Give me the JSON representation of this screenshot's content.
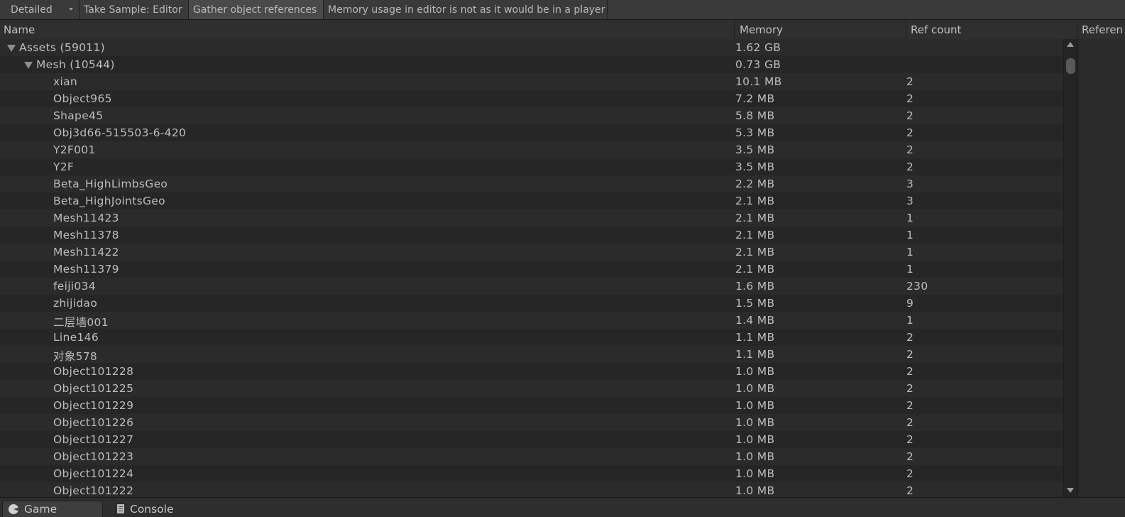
{
  "toolbar": {
    "mode_dropdown": "Detailed",
    "take_sample": "Take Sample: Editor",
    "gather_refs": "Gather object references",
    "note": "Memory usage in editor is not as it would be in a player"
  },
  "columns": {
    "name": "Name",
    "memory": "Memory",
    "ref_count": "Ref count",
    "referenced_by": "Referen"
  },
  "tree": {
    "assets": {
      "label": "Assets (59011)",
      "memory": "1.62 GB"
    },
    "mesh": {
      "label": "Mesh (10544)",
      "memory": "0.73 GB"
    }
  },
  "rows": [
    {
      "name": "xian",
      "memory": "10.1 MB",
      "refs": "2"
    },
    {
      "name": "Object965",
      "memory": "7.2 MB",
      "refs": "2"
    },
    {
      "name": "Shape45",
      "memory": "5.8 MB",
      "refs": "2"
    },
    {
      "name": "Obj3d66-515503-6-420",
      "memory": "5.3 MB",
      "refs": "2"
    },
    {
      "name": "Y2F001",
      "memory": "3.5 MB",
      "refs": "2"
    },
    {
      "name": "Y2F",
      "memory": "3.5 MB",
      "refs": "2"
    },
    {
      "name": "Beta_HighLimbsGeo",
      "memory": "2.2 MB",
      "refs": "3"
    },
    {
      "name": "Beta_HighJointsGeo",
      "memory": "2.1 MB",
      "refs": "3"
    },
    {
      "name": "Mesh11423",
      "memory": "2.1 MB",
      "refs": "1"
    },
    {
      "name": "Mesh11378",
      "memory": "2.1 MB",
      "refs": "1"
    },
    {
      "name": "Mesh11422",
      "memory": "2.1 MB",
      "refs": "1"
    },
    {
      "name": "Mesh11379",
      "memory": "2.1 MB",
      "refs": "1"
    },
    {
      "name": "feiji034",
      "memory": "1.6 MB",
      "refs": "230"
    },
    {
      "name": "zhijidao",
      "memory": "1.5 MB",
      "refs": "9"
    },
    {
      "name": "二层墙001",
      "memory": "1.4 MB",
      "refs": "1"
    },
    {
      "name": "Line146",
      "memory": "1.1 MB",
      "refs": "2"
    },
    {
      "name": "对象578",
      "memory": "1.1 MB",
      "refs": "2"
    },
    {
      "name": "Object101228",
      "memory": "1.0 MB",
      "refs": "2"
    },
    {
      "name": "Object101225",
      "memory": "1.0 MB",
      "refs": "2"
    },
    {
      "name": "Object101229",
      "memory": "1.0 MB",
      "refs": "2"
    },
    {
      "name": "Object101226",
      "memory": "1.0 MB",
      "refs": "2"
    },
    {
      "name": "Object101227",
      "memory": "1.0 MB",
      "refs": "2"
    },
    {
      "name": "Object101223",
      "memory": "1.0 MB",
      "refs": "2"
    },
    {
      "name": "Object101224",
      "memory": "1.0 MB",
      "refs": "2"
    },
    {
      "name": "Object101222",
      "memory": "1.0 MB",
      "refs": "2"
    }
  ],
  "bottom_tabs": {
    "game": "Game",
    "console": "Console"
  }
}
